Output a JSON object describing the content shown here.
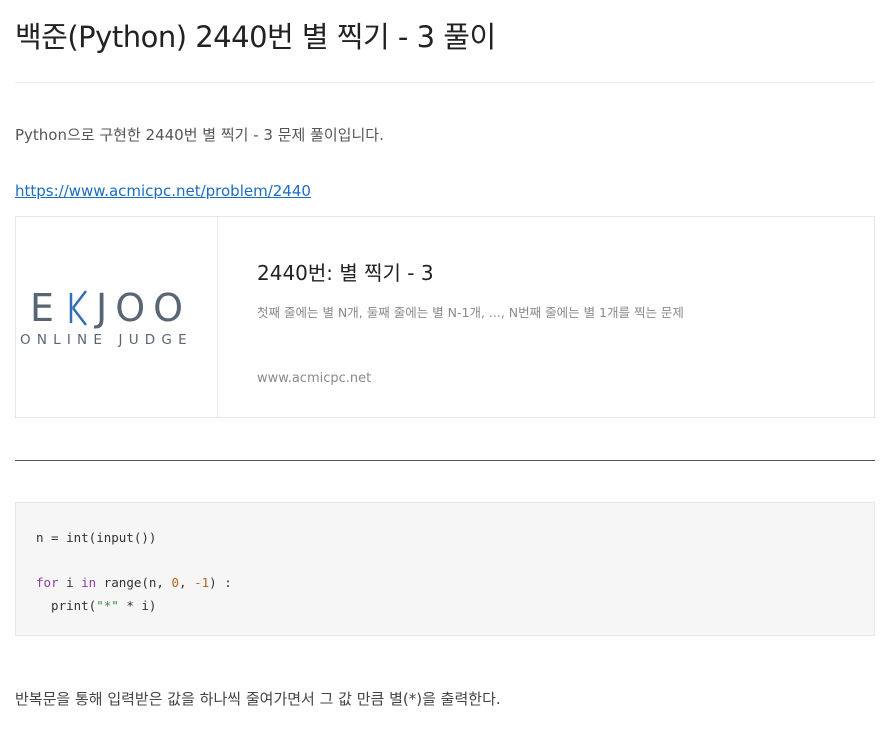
{
  "post": {
    "title": "백준(Python) 2440번 별 찍기 - 3 풀이",
    "intro": "Python으로 구현한 2440번 별 찍기 - 3 문제 풀이입니다.",
    "link": "https://www.acmicpc.net/problem/2440",
    "outro": "반복문을 통해 입력받은 값을 하나씩 줄여가면서 그 값 만큼 별(*)을 출력한다."
  },
  "card": {
    "logo_text": "BAEKJOON",
    "logo_sub": "ONLINE JUDGE",
    "title": "2440번: 별 찍기 - 3",
    "description": "첫째 줄에는 별 N개, 둘째 줄에는 별 N-1개, ..., N번째 줄에는 별 1개를 찍는 문제",
    "url": "www.acmicpc.net"
  },
  "code": {
    "line1": "n = int(input())",
    "for_kw": "for",
    "var": " i ",
    "in_kw": "in",
    "range_pre": " range(n, ",
    "zero": "0",
    "comma": ", ",
    "neg_one": "-1",
    "range_post": ") :",
    "print_pre": "  print(",
    "str": "\"*\"",
    "print_post": " * i)"
  },
  "colors": {
    "link": "#1a6cc4",
    "keyword": "#8e3ea6",
    "number": "#b5651d",
    "string": "#3d8b3d",
    "logo_gray": "#5a6573",
    "logo_blue": "#2f6fb8"
  }
}
